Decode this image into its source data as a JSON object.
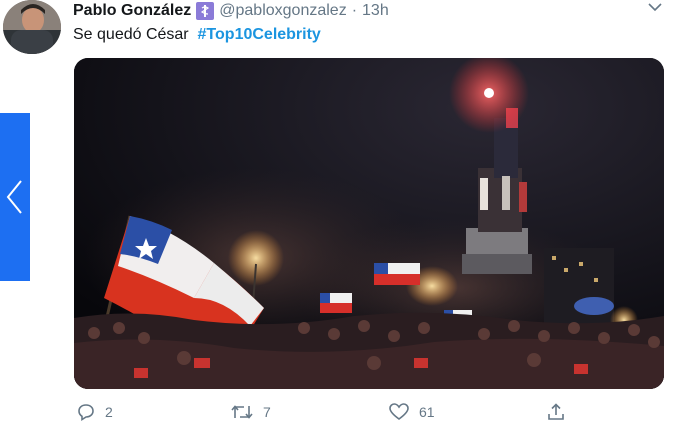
{
  "tweet": {
    "display_name": "Pablo González",
    "badge_icon": "medical-staff-icon",
    "handle": "@pabloxgonzalez",
    "separator": "·",
    "time": "13h",
    "text": "Se quedó César",
    "hashtag": "#Top10Celebrity",
    "media_alt_subject": "crowd-with-chilean-flags-at-night"
  },
  "actions": {
    "reply_count": "2",
    "retweet_count": "7",
    "like_count": "61"
  },
  "colors": {
    "accent": "#1b95e0",
    "nav_arrow_bg": "#1d6ff2",
    "muted": "#657786"
  }
}
